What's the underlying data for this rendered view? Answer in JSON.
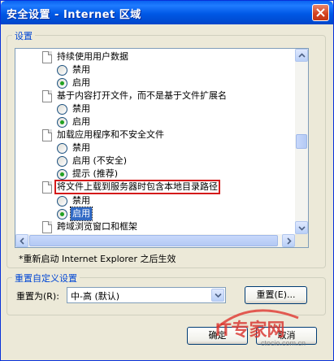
{
  "window": {
    "title": "安全设置 - Internet 区域"
  },
  "settings_group": {
    "label": "设置",
    "items": [
      {
        "type": "header",
        "label": "持续使用用户数据"
      },
      {
        "type": "option",
        "label": "禁用",
        "checked": false
      },
      {
        "type": "option",
        "label": "启用",
        "checked": true
      },
      {
        "type": "header",
        "label": "基于内容打开文件，而不是基于文件扩展名"
      },
      {
        "type": "option",
        "label": "禁用",
        "checked": false
      },
      {
        "type": "option",
        "label": "启用",
        "checked": true
      },
      {
        "type": "header",
        "label": "加载应用程序和不安全文件"
      },
      {
        "type": "option",
        "label": "禁用",
        "checked": false
      },
      {
        "type": "option",
        "label": "启用 (不安全)",
        "checked": false
      },
      {
        "type": "option",
        "label": "提示 (推荐)",
        "checked": true
      },
      {
        "type": "header",
        "label": "将文件上载到服务器时包含本地目录路径",
        "highlighted": true
      },
      {
        "type": "option",
        "label": "禁用",
        "checked": false
      },
      {
        "type": "option",
        "label": "启用",
        "checked": true,
        "selected": true
      },
      {
        "type": "header",
        "label": "跨域浏览窗口和框架"
      }
    ]
  },
  "restart_note": "*重新启动 Internet Explorer 之后生效",
  "reset_group": {
    "label": "重置自定义设置",
    "reset_to_label": "重置为(R):",
    "reset_to_value": "中-高 (默认)",
    "reset_button": "重置(E)..."
  },
  "footer": {
    "ok_button": "确定",
    "cancel_button": "取消"
  },
  "watermark": {
    "text_main": "IT专家网",
    "text_sub": "ctocio.com.cn"
  },
  "colors": {
    "title_bar": "#0058e6",
    "group_label": "#0046d5",
    "highlight_border": "#d41a1a",
    "selection": "#316ac5"
  }
}
